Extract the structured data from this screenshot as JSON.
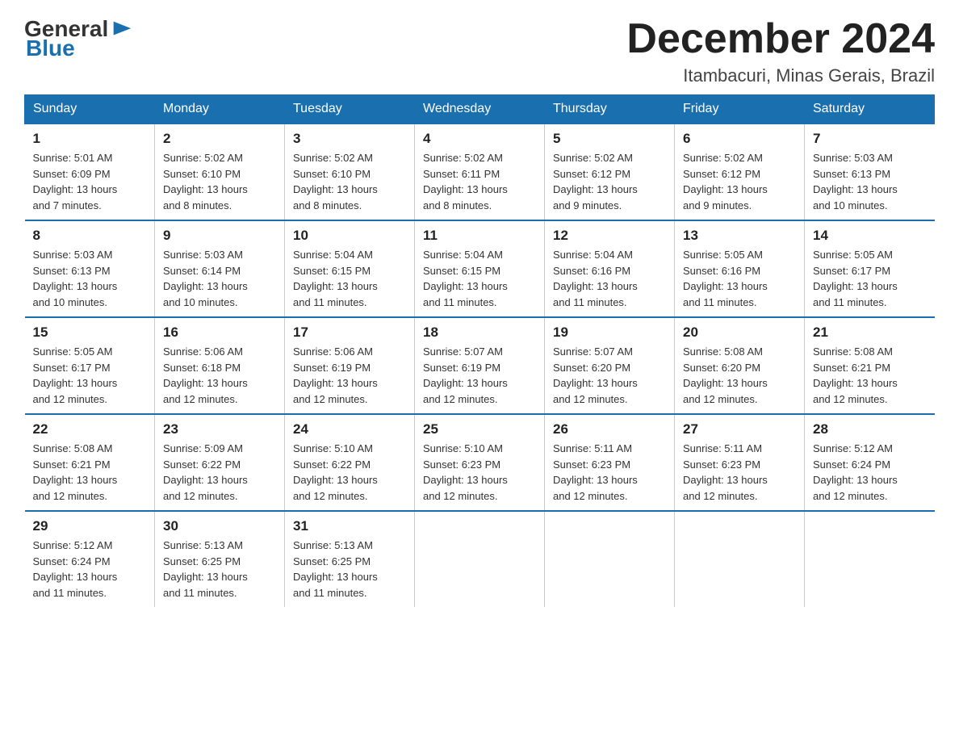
{
  "header": {
    "logo_general": "General",
    "logo_blue": "Blue",
    "month_title": "December 2024",
    "location": "Itambacuri, Minas Gerais, Brazil"
  },
  "days_of_week": [
    "Sunday",
    "Monday",
    "Tuesday",
    "Wednesday",
    "Thursday",
    "Friday",
    "Saturday"
  ],
  "weeks": [
    [
      {
        "day": "1",
        "sunrise": "5:01 AM",
        "sunset": "6:09 PM",
        "daylight": "13 hours and 7 minutes."
      },
      {
        "day": "2",
        "sunrise": "5:02 AM",
        "sunset": "6:10 PM",
        "daylight": "13 hours and 8 minutes."
      },
      {
        "day": "3",
        "sunrise": "5:02 AM",
        "sunset": "6:10 PM",
        "daylight": "13 hours and 8 minutes."
      },
      {
        "day": "4",
        "sunrise": "5:02 AM",
        "sunset": "6:11 PM",
        "daylight": "13 hours and 8 minutes."
      },
      {
        "day": "5",
        "sunrise": "5:02 AM",
        "sunset": "6:12 PM",
        "daylight": "13 hours and 9 minutes."
      },
      {
        "day": "6",
        "sunrise": "5:02 AM",
        "sunset": "6:12 PM",
        "daylight": "13 hours and 9 minutes."
      },
      {
        "day": "7",
        "sunrise": "5:03 AM",
        "sunset": "6:13 PM",
        "daylight": "13 hours and 10 minutes."
      }
    ],
    [
      {
        "day": "8",
        "sunrise": "5:03 AM",
        "sunset": "6:13 PM",
        "daylight": "13 hours and 10 minutes."
      },
      {
        "day": "9",
        "sunrise": "5:03 AM",
        "sunset": "6:14 PM",
        "daylight": "13 hours and 10 minutes."
      },
      {
        "day": "10",
        "sunrise": "5:04 AM",
        "sunset": "6:15 PM",
        "daylight": "13 hours and 11 minutes."
      },
      {
        "day": "11",
        "sunrise": "5:04 AM",
        "sunset": "6:15 PM",
        "daylight": "13 hours and 11 minutes."
      },
      {
        "day": "12",
        "sunrise": "5:04 AM",
        "sunset": "6:16 PM",
        "daylight": "13 hours and 11 minutes."
      },
      {
        "day": "13",
        "sunrise": "5:05 AM",
        "sunset": "6:16 PM",
        "daylight": "13 hours and 11 minutes."
      },
      {
        "day": "14",
        "sunrise": "5:05 AM",
        "sunset": "6:17 PM",
        "daylight": "13 hours and 11 minutes."
      }
    ],
    [
      {
        "day": "15",
        "sunrise": "5:05 AM",
        "sunset": "6:17 PM",
        "daylight": "13 hours and 12 minutes."
      },
      {
        "day": "16",
        "sunrise": "5:06 AM",
        "sunset": "6:18 PM",
        "daylight": "13 hours and 12 minutes."
      },
      {
        "day": "17",
        "sunrise": "5:06 AM",
        "sunset": "6:19 PM",
        "daylight": "13 hours and 12 minutes."
      },
      {
        "day": "18",
        "sunrise": "5:07 AM",
        "sunset": "6:19 PM",
        "daylight": "13 hours and 12 minutes."
      },
      {
        "day": "19",
        "sunrise": "5:07 AM",
        "sunset": "6:20 PM",
        "daylight": "13 hours and 12 minutes."
      },
      {
        "day": "20",
        "sunrise": "5:08 AM",
        "sunset": "6:20 PM",
        "daylight": "13 hours and 12 minutes."
      },
      {
        "day": "21",
        "sunrise": "5:08 AM",
        "sunset": "6:21 PM",
        "daylight": "13 hours and 12 minutes."
      }
    ],
    [
      {
        "day": "22",
        "sunrise": "5:08 AM",
        "sunset": "6:21 PM",
        "daylight": "13 hours and 12 minutes."
      },
      {
        "day": "23",
        "sunrise": "5:09 AM",
        "sunset": "6:22 PM",
        "daylight": "13 hours and 12 minutes."
      },
      {
        "day": "24",
        "sunrise": "5:10 AM",
        "sunset": "6:22 PM",
        "daylight": "13 hours and 12 minutes."
      },
      {
        "day": "25",
        "sunrise": "5:10 AM",
        "sunset": "6:23 PM",
        "daylight": "13 hours and 12 minutes."
      },
      {
        "day": "26",
        "sunrise": "5:11 AM",
        "sunset": "6:23 PM",
        "daylight": "13 hours and 12 minutes."
      },
      {
        "day": "27",
        "sunrise": "5:11 AM",
        "sunset": "6:23 PM",
        "daylight": "13 hours and 12 minutes."
      },
      {
        "day": "28",
        "sunrise": "5:12 AM",
        "sunset": "6:24 PM",
        "daylight": "13 hours and 12 minutes."
      }
    ],
    [
      {
        "day": "29",
        "sunrise": "5:12 AM",
        "sunset": "6:24 PM",
        "daylight": "13 hours and 11 minutes."
      },
      {
        "day": "30",
        "sunrise": "5:13 AM",
        "sunset": "6:25 PM",
        "daylight": "13 hours and 11 minutes."
      },
      {
        "day": "31",
        "sunrise": "5:13 AM",
        "sunset": "6:25 PM",
        "daylight": "13 hours and 11 minutes."
      },
      null,
      null,
      null,
      null
    ]
  ],
  "labels": {
    "sunrise": "Sunrise:",
    "sunset": "Sunset:",
    "daylight": "Daylight:"
  }
}
